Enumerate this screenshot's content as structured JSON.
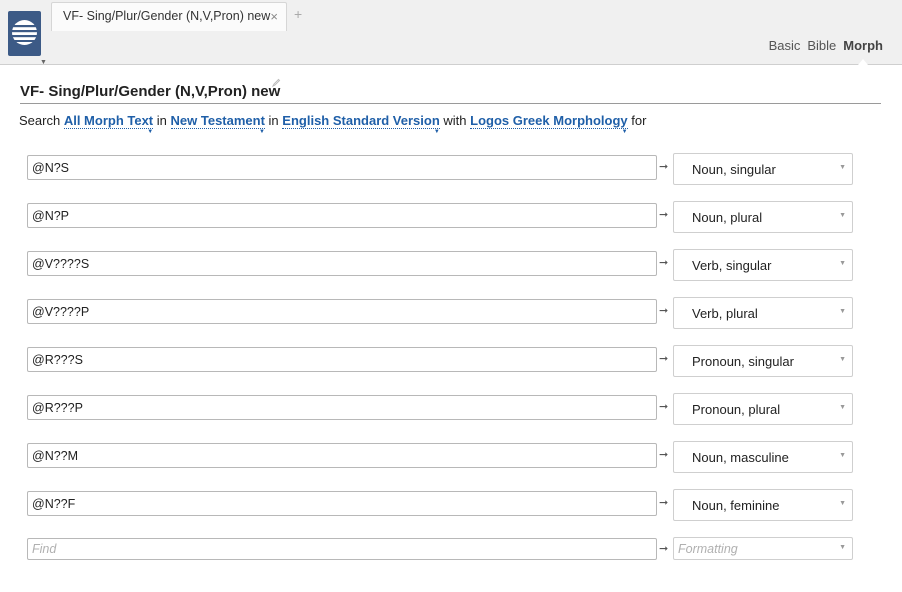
{
  "tab": {
    "title": "VF- Sing/Plur/Gender (N,V,Pron) new",
    "close": "×",
    "add": "+"
  },
  "modes": [
    "Basic",
    "Bible",
    "Morph"
  ],
  "active_mode": "Morph",
  "panel": {
    "title": "VF- Sing/Plur/Gender (N,V,Pron) new",
    "edit_icon": "pencil"
  },
  "search": {
    "w_search": "Search",
    "scope": "All Morph Text",
    "w_in1": "in",
    "range": "New Testament",
    "w_in2": "in",
    "version": "English Standard Version",
    "w_with": "with",
    "morphology": "Logos Greek Morphology",
    "w_for": "for"
  },
  "rows": [
    {
      "query": "@N?S",
      "format": "Noun, singular"
    },
    {
      "query": "@N?P",
      "format": "Noun, plural"
    },
    {
      "query": "@V????S",
      "format": "Verb, singular"
    },
    {
      "query": "@V????P",
      "format": "Verb, plural"
    },
    {
      "query": "@R???S",
      "format": "Pronoun, singular"
    },
    {
      "query": "@R???P",
      "format": "Pronoun, plural"
    },
    {
      "query": "@N??M",
      "format": "Noun, masculine"
    },
    {
      "query": "@N??F",
      "format": "Noun, feminine"
    }
  ],
  "new_row": {
    "find_placeholder": "Find",
    "format_placeholder": "Formatting"
  },
  "arrow": "➞",
  "colors": {
    "accent": "#1f5fa8",
    "app_icon": "#3c5a86"
  }
}
